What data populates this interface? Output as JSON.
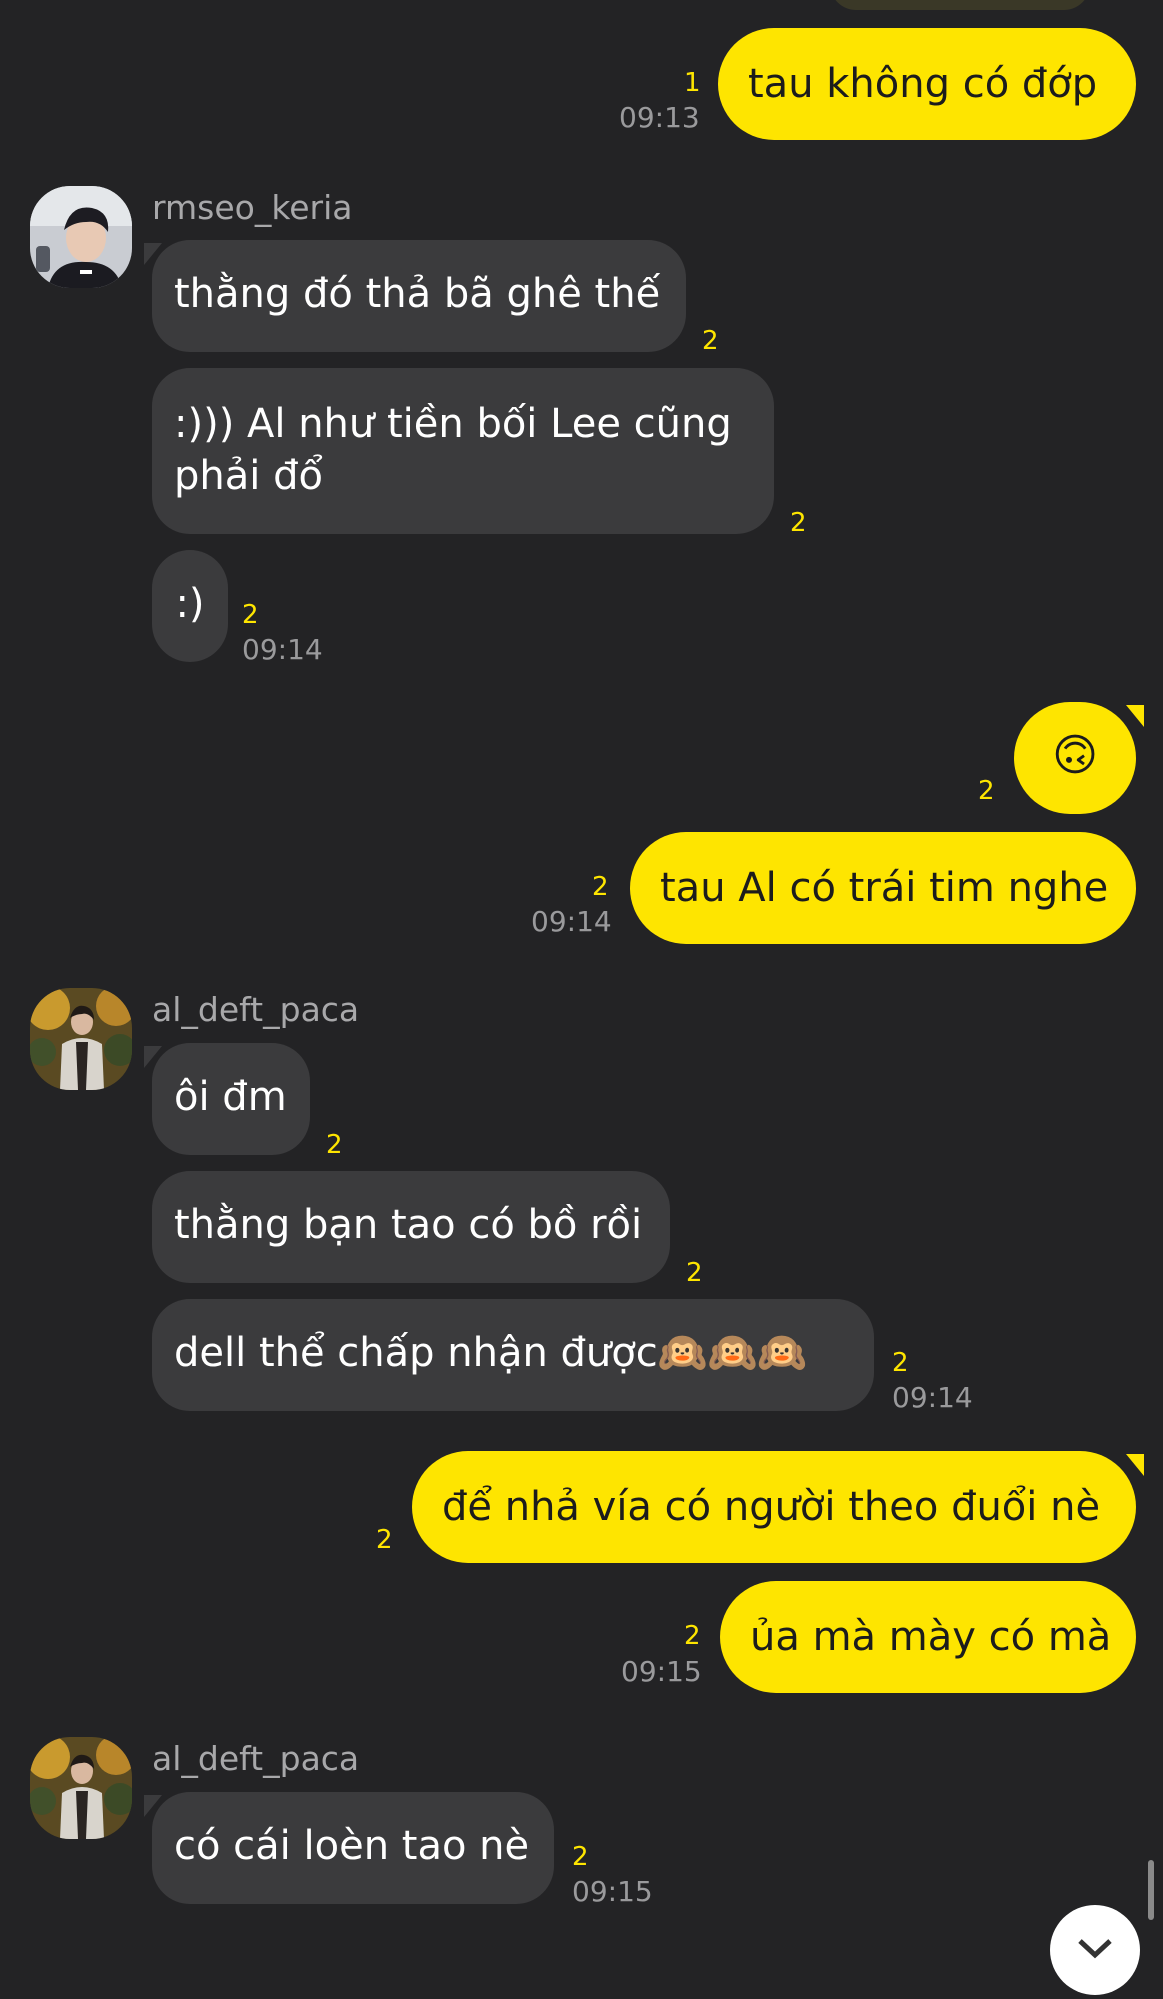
{
  "chat": {
    "m1": {
      "text": "tau không có đớp",
      "unread": "1",
      "time": "09:13"
    },
    "u1": {
      "name": "rmseo_keria"
    },
    "m2": {
      "text": "thằng đó thả bã ghê thế",
      "unread": "2"
    },
    "m3": {
      "line1": ":))) Al như tiền bối Lee cũng",
      "line2": "phải đổ",
      "unread": "2"
    },
    "m4": {
      "text": ":)",
      "unread": "2",
      "time": "09:14"
    },
    "m5": {
      "text": "🙃",
      "unread": "2"
    },
    "m6": {
      "text": "tau Al có trái tim nghe",
      "unread": "2",
      "time": "09:14"
    },
    "u2": {
      "name": "al_deft_paca"
    },
    "m7": {
      "text": "ôi đm",
      "unread": "2"
    },
    "m8": {
      "text": "thằng bạn tao có bồ rồi",
      "unread": "2"
    },
    "m9": {
      "text": "dell thể chấp nhận được🙉🙉🙉",
      "unread": "2",
      "time": "09:14"
    },
    "m10": {
      "text": "để nhả vía có người theo đuổi nè",
      "unread": "2"
    },
    "m11": {
      "text": "ủa mà mày có mà",
      "unread": "2",
      "time": "09:15"
    },
    "u3": {
      "name": "al_deft_paca"
    },
    "m12": {
      "text": "có cái loèn tao nè",
      "unread": "2",
      "time": "09:15"
    }
  },
  "colors": {
    "background": "#232325",
    "my_bubble": "#fee500",
    "other_bubble": "#3b3b3d",
    "unread_count": "#fee500",
    "timestamp": "#9a9a9c"
  },
  "icons": {
    "avatar_keria": "profile-photo",
    "avatar_deft": "profile-photo",
    "scroll_down": "chevron-down-icon"
  }
}
